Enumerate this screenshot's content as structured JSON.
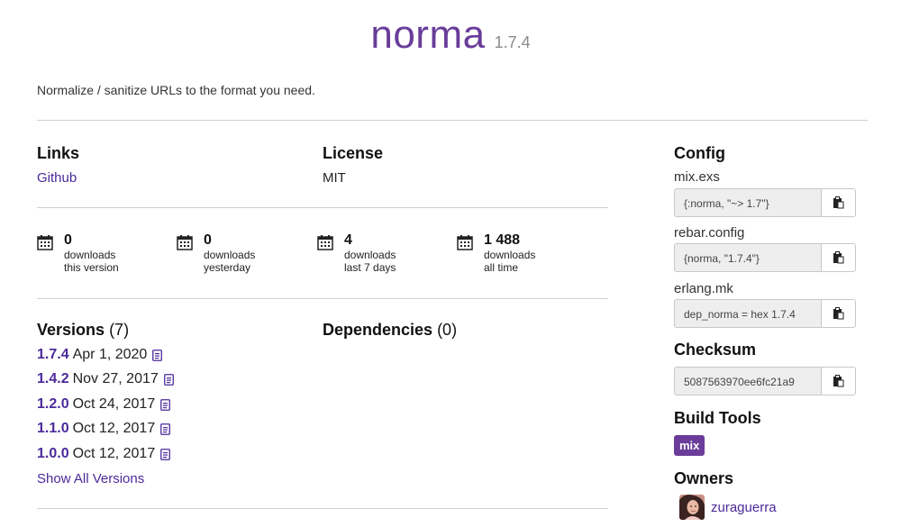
{
  "package": {
    "name": "norma",
    "version": "1.7.4",
    "description": "Normalize / sanitize URLs to the format you need."
  },
  "links": {
    "title": "Links",
    "items": [
      "Github"
    ]
  },
  "license": {
    "title": "License",
    "value": "MIT"
  },
  "stats": [
    {
      "value": "0",
      "line1": "downloads",
      "line2": "this version",
      "icon": "calendar-icon"
    },
    {
      "value": "0",
      "line1": "downloads",
      "line2": "yesterday",
      "icon": "calendar-icon"
    },
    {
      "value": "4",
      "line1": "downloads",
      "line2": "last 7 days",
      "icon": "calendar-icon"
    },
    {
      "value": "1 488",
      "line1": "downloads",
      "line2": "all time",
      "icon": "calendar-icon"
    }
  ],
  "versions": {
    "title": "Versions",
    "count": "(7)",
    "items": [
      {
        "version": "1.7.4",
        "date": "Apr 1, 2020"
      },
      {
        "version": "1.4.2",
        "date": "Nov 27, 2017"
      },
      {
        "version": "1.2.0",
        "date": "Oct 24, 2017"
      },
      {
        "version": "1.1.0",
        "date": "Oct 12, 2017"
      },
      {
        "version": "1.0.0",
        "date": "Oct 12, 2017"
      }
    ],
    "show_all": "Show All Versions"
  },
  "dependencies": {
    "title": "Dependencies",
    "count": "(0)"
  },
  "config": {
    "title": "Config",
    "items": [
      {
        "label": "mix.exs",
        "code": "{:norma, \"~> 1.7\"}"
      },
      {
        "label": "rebar.config",
        "code": "{norma, \"1.7.4\"}"
      },
      {
        "label": "erlang.mk",
        "code": "dep_norma = hex 1.7.4"
      }
    ]
  },
  "checksum": {
    "title": "Checksum",
    "value": "5087563970ee6fc21a9"
  },
  "build_tools": {
    "title": "Build Tools",
    "items": [
      "mix"
    ]
  },
  "owners": {
    "title": "Owners",
    "items": [
      "zuraguerra"
    ]
  },
  "colors": {
    "brand": "#6a3d9a",
    "link": "#4b2a9a",
    "rule": "#d0d0d0"
  }
}
